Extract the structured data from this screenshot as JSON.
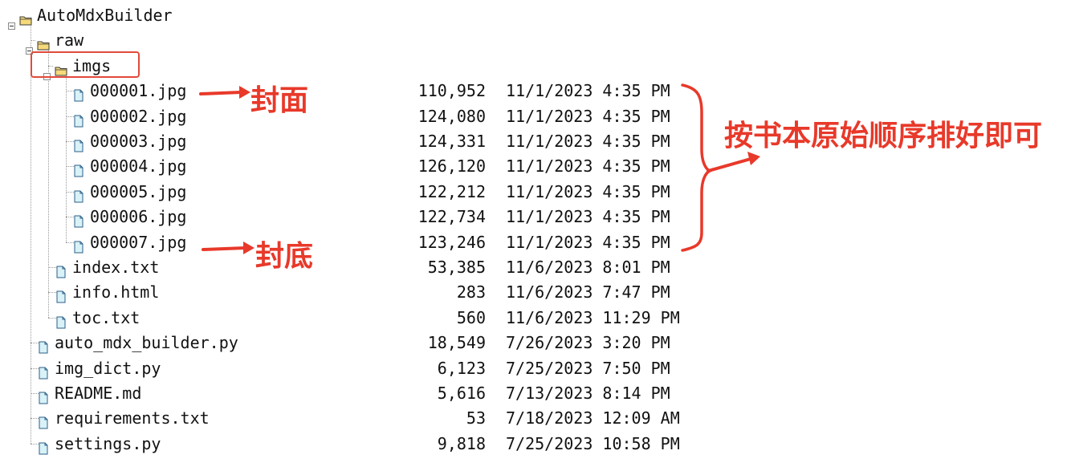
{
  "tree": [
    {
      "name": "AutoMdxBuilder",
      "type": "folder",
      "expand": "minus",
      "level": 0
    },
    {
      "name": "raw",
      "type": "folder",
      "expand": "minus",
      "level": 1
    },
    {
      "name": "imgs",
      "type": "folder",
      "expand": "minus",
      "level": 2
    },
    {
      "name": "000001.jpg",
      "type": "file",
      "level": 3,
      "size": "110,952",
      "date": "11/1/2023 4:35 PM"
    },
    {
      "name": "000002.jpg",
      "type": "file",
      "level": 3,
      "size": "124,080",
      "date": "11/1/2023 4:35 PM"
    },
    {
      "name": "000003.jpg",
      "type": "file",
      "level": 3,
      "size": "124,331",
      "date": "11/1/2023 4:35 PM"
    },
    {
      "name": "000004.jpg",
      "type": "file",
      "level": 3,
      "size": "126,120",
      "date": "11/1/2023 4:35 PM"
    },
    {
      "name": "000005.jpg",
      "type": "file",
      "level": 3,
      "size": "122,212",
      "date": "11/1/2023 4:35 PM"
    },
    {
      "name": "000006.jpg",
      "type": "file",
      "level": 3,
      "size": "122,734",
      "date": "11/1/2023 4:35 PM"
    },
    {
      "name": "000007.jpg",
      "type": "file",
      "level": 3,
      "size": "123,246",
      "date": "11/1/2023 4:35 PM"
    },
    {
      "name": "index.txt",
      "type": "file",
      "level": 2,
      "size": "53,385",
      "date": "11/6/2023 8:01 PM"
    },
    {
      "name": "info.html",
      "type": "file",
      "level": 2,
      "size": "283",
      "date": "11/6/2023 7:47 PM"
    },
    {
      "name": "toc.txt",
      "type": "file",
      "level": 2,
      "size": "560",
      "date": "11/6/2023 11:29 PM"
    },
    {
      "name": "auto_mdx_builder.py",
      "type": "file",
      "level": 1,
      "size": "18,549",
      "date": "7/26/2023 3:20 PM"
    },
    {
      "name": "img_dict.py",
      "type": "file",
      "level": 1,
      "size": "6,123",
      "date": "7/25/2023 7:50 PM"
    },
    {
      "name": "README.md",
      "type": "file",
      "level": 1,
      "size": "5,616",
      "date": "7/13/2023 8:14 PM"
    },
    {
      "name": "requirements.txt",
      "type": "file",
      "level": 1,
      "size": "53",
      "date": "7/18/2023 12:09 AM"
    },
    {
      "name": "settings.py",
      "type": "file",
      "level": 1,
      "size": "9,818",
      "date": "7/25/2023 10:58 PM"
    }
  ],
  "annotations": {
    "cover_label": "封面",
    "back_cover_label": "封底",
    "order_note": "按书本原始顺序排好即可",
    "color": "#e8392a"
  },
  "colors": {
    "folder_fill": "#f6d97a",
    "folder_stroke": "#3a3a3a",
    "file_fill": "#d9f2f7",
    "file_stroke": "#2b5f8a",
    "highlight": "#e24a3b"
  }
}
